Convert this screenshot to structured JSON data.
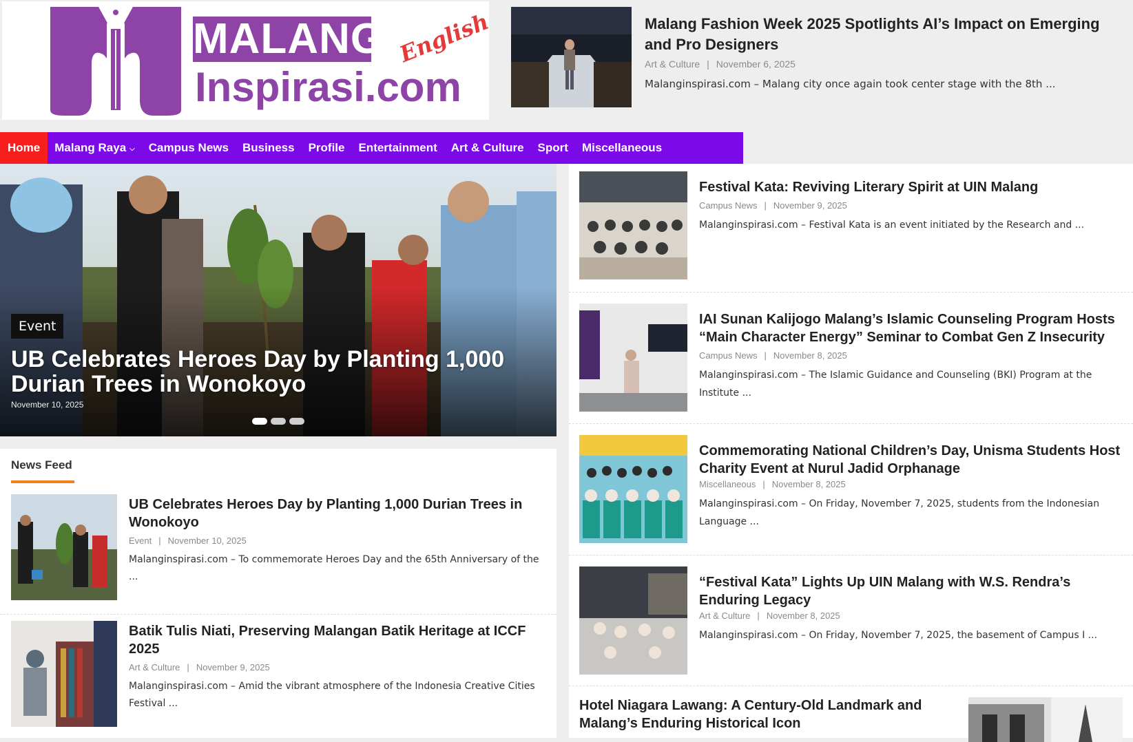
{
  "logo": {
    "word_top": "MALANG",
    "word_bottom": "Inspirasi.com",
    "tag": "English"
  },
  "top_article": {
    "title": "Malang Fashion Week 2025 Spotlights AI’s Impact on Emerging and Pro Designers",
    "category": "Art & Culture",
    "date": "November 6, 2025",
    "excerpt": "Malanginspirasi.com – Malang city once again took center stage with the 8th ..."
  },
  "nav": {
    "items": [
      {
        "label": "Home",
        "active": true
      },
      {
        "label": "Malang Raya",
        "dropdown": true
      },
      {
        "label": "Campus News"
      },
      {
        "label": "Business"
      },
      {
        "label": "Profile"
      },
      {
        "label": "Entertainment"
      },
      {
        "label": "Art & Culture"
      },
      {
        "label": "Sport"
      },
      {
        "label": "Miscellaneous"
      }
    ],
    "dropdown_glyph": "⌵"
  },
  "hero": {
    "category": "Event",
    "title": "UB Celebrates Heroes Day by Planting 1,000 Durian Trees in Wonokoyo",
    "date": "November 10, 2025",
    "slides": 3,
    "active_slide": 1
  },
  "feed": {
    "heading": "News Feed",
    "items": [
      {
        "title": "UB Celebrates Heroes Day by Planting 1,000 Durian Trees in Wonokoyo",
        "category": "Event",
        "date": "November 10, 2025",
        "excerpt": "Malanginspirasi.com – To commemorate Heroes Day and the 65th Anniversary of the ..."
      },
      {
        "title": "Batik Tulis Niati, Preserving Malangan Batik Heritage at ICCF 2025",
        "category": "Art & Culture",
        "date": "November 9, 2025",
        "excerpt": "Malanginspirasi.com – Amid the vibrant atmosphere of the Indonesia Creative Cities Festival ..."
      }
    ]
  },
  "sidebar": {
    "items": [
      {
        "title": "Festival Kata: Reviving Literary Spirit at UIN Malang",
        "category": "Campus News",
        "date": "November 9, 2025",
        "excerpt": "Malanginspirasi.com – Festival Kata is an event initiated by the Research and ..."
      },
      {
        "title": "IAI Sunan Kalijogo Malang’s Islamic Counseling Program Hosts “Main Character Energy” Seminar to Combat Gen Z Insecurity",
        "category": "Campus News",
        "date": "November 8, 2025",
        "excerpt": "Malanginspirasi.com – The Islamic Guidance and Counseling (BKI) Program at the Institute ..."
      },
      {
        "title": "Commemorating National Children’s Day, Unisma Students Host Charity Event at Nurul Jadid Orphanage",
        "category": "Miscellaneous",
        "date": "November 8, 2025",
        "excerpt": "Malanginspirasi.com – On Friday, November 7, 2025, students from the Indonesian Language ..."
      },
      {
        "title": "“Festival Kata” Lights Up UIN Malang with W.S. Rendra’s Enduring Legacy",
        "category": "Art & Culture",
        "date": "November 8, 2025",
        "excerpt": "Malanginspirasi.com – On Friday, November 7, 2025, the basement of Campus I ..."
      }
    ],
    "last": {
      "title": "Hotel Niagara Lawang: A Century-Old Landmark and Malang’s Enduring Historical Icon"
    }
  },
  "meta_separator": "|",
  "colors": {
    "nav_bg": "#7b09e8",
    "nav_active": "#f71e1e",
    "brand_purple": "#8e44a7",
    "feed_accent": "#f4811f"
  }
}
